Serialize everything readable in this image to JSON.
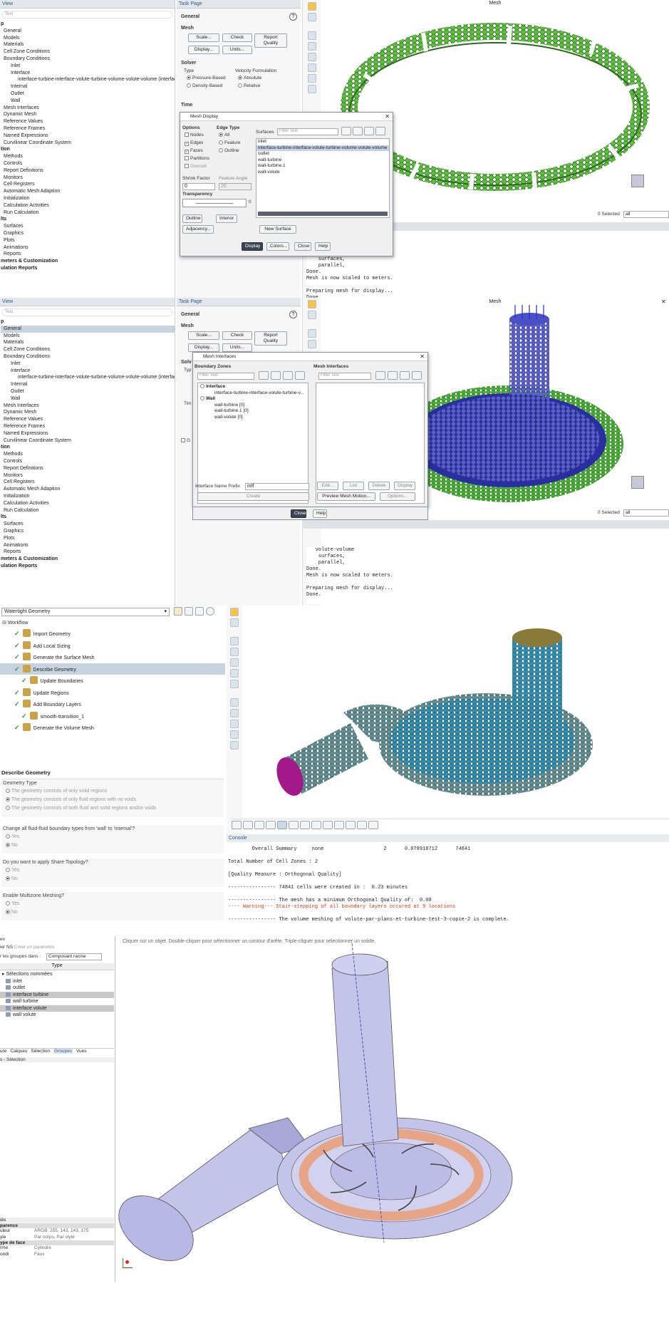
{
  "p1": {
    "tree_header": "View",
    "search_placeholder": "Text",
    "tree": [
      {
        "label": "p",
        "bold": true
      },
      {
        "label": "General",
        "icon": false
      },
      {
        "label": "Models"
      },
      {
        "label": "Materials"
      },
      {
        "label": "Cell Zone Conditions"
      },
      {
        "label": "Boundary Conditions"
      },
      {
        "label": "Inlet",
        "indent": 1
      },
      {
        "label": "Interface",
        "indent": 1
      },
      {
        "label": "interface-turbine-interface-volute-turbine-volume-volute-volume (interfac",
        "indent": 2
      },
      {
        "label": "Internal",
        "indent": 1
      },
      {
        "label": "Outlet",
        "indent": 1
      },
      {
        "label": "Wall",
        "indent": 1
      },
      {
        "label": "Mesh Interfaces"
      },
      {
        "label": "Dynamic Mesh"
      },
      {
        "label": "Reference Values"
      },
      {
        "label": "Reference Frames"
      },
      {
        "label": "Named Expressions"
      },
      {
        "label": "Curvilinear Coordinate System"
      },
      {
        "label": "tion",
        "bold": true
      },
      {
        "label": "Methods"
      },
      {
        "label": "Controls"
      },
      {
        "label": "Report Definitions"
      },
      {
        "label": "Monitors"
      },
      {
        "label": "Cell Registers"
      },
      {
        "label": "Automatic Mesh Adaption"
      },
      {
        "label": "Initialization"
      },
      {
        "label": "Calculation Activities"
      },
      {
        "label": "Run Calculation"
      },
      {
        "label": "lts",
        "bold": true
      },
      {
        "label": "Surfaces"
      },
      {
        "label": "Graphics"
      },
      {
        "label": "Plots"
      },
      {
        "label": "Animations"
      },
      {
        "label": "Reports"
      },
      {
        "label": "meters & Customization",
        "bold": true
      },
      {
        "label": "ulation Reports",
        "bold": true
      }
    ],
    "task_header": "Task Page",
    "general": "General",
    "mesh": "Mesh",
    "scale": "Scale...",
    "check": "Check",
    "report_quality": "Report Quality",
    "display": "Display...",
    "units": "Units...",
    "solver": "Solver",
    "type": "Type",
    "pressure_based": "Pressure-Based",
    "density_based": "Density-Based",
    "velocity_formulation": "Velocity Formulation",
    "absolute": "Absolute",
    "relative": "Relative",
    "time": "Time",
    "viewport_title": "Mesh",
    "selected": "0 Selected",
    "selected_filter": "all",
    "console": "    surfaces,\n    parallel,\nDone.\nMesh is now scaled to meters.\n\nPreparing mesh for display...\nDone.",
    "dialog": {
      "title": "Mesh Display",
      "options": "Options",
      "nodes": "Nodes",
      "edges": "Edges",
      "faces": "Faces",
      "partitions": "Partitions",
      "overset": "Overset",
      "edge_type": "Edge Type",
      "all": "All",
      "feature": "Feature",
      "outline": "Outline",
      "surfaces": "Surfaces",
      "filter": "Filter Text",
      "surface_list": [
        "inlet",
        "interface-turbine-interface-volute-turbine-volume-volute-volume",
        "outlet",
        "wall-turbine",
        "wall-turbine.1",
        "wall-volute"
      ],
      "shrink_factor": "Shrink Factor",
      "shrink_value": "0",
      "feature_angle": "Feature Angle",
      "feature_value": "20",
      "transparency": "Transparency",
      "trans_value": "0",
      "outline_btn": "Outline",
      "interior_btn": "Interior",
      "adjacency_btn": "Adjacency...",
      "new_surface_btn": "New Surface",
      "display_btn": "Display",
      "colors_btn": "Colors...",
      "close_btn": "Close",
      "help_btn": "Help"
    }
  },
  "p2": {
    "tree_header": "View",
    "search_placeholder": "Text",
    "tree": [
      {
        "label": "p",
        "bold": true
      },
      {
        "label": "General",
        "sel": true
      },
      {
        "label": "Models"
      },
      {
        "label": "Materials"
      },
      {
        "label": "Cell Zone Conditions"
      },
      {
        "label": "Boundary Conditions"
      },
      {
        "label": "Inlet",
        "indent": 1
      },
      {
        "label": "Interface",
        "indent": 1
      },
      {
        "label": "interface-turbine-interface-volute-turbine-volume-volute-volume (interfac",
        "indent": 2
      },
      {
        "label": "Internal",
        "indent": 1
      },
      {
        "label": "Outlet",
        "indent": 1
      },
      {
        "label": "Wall",
        "indent": 1
      },
      {
        "label": "Mesh Interfaces"
      },
      {
        "label": "Dynamic Mesh"
      },
      {
        "label": "Reference Values"
      },
      {
        "label": "Reference Frames"
      },
      {
        "label": "Named Expressions"
      },
      {
        "label": "Curvilinear Coordinate System"
      },
      {
        "label": "tion",
        "bold": true
      },
      {
        "label": "Methods"
      },
      {
        "label": "Controls"
      },
      {
        "label": "Report Definitions"
      },
      {
        "label": "Monitors"
      },
      {
        "label": "Cell Registers"
      },
      {
        "label": "Automatic Mesh Adaption"
      },
      {
        "label": "Initialization"
      },
      {
        "label": "Calculation Activities"
      },
      {
        "label": "Run Calculation"
      },
      {
        "label": "lts",
        "bold": true
      },
      {
        "label": "Surfaces"
      },
      {
        "label": "Graphics"
      },
      {
        "label": "Plots"
      },
      {
        "label": "Animations"
      },
      {
        "label": "Reports"
      },
      {
        "label": "meters & Customization",
        "bold": true
      },
      {
        "label": "ulation Reports",
        "bold": true
      }
    ],
    "task_header": "Task Page",
    "general": "General",
    "mesh": "Mesh",
    "scale": "Scale...",
    "check": "Check",
    "report_quality": "Report Quality",
    "display": "Display...",
    "units": "Units...",
    "solver_trunc": "Solv",
    "type_trunc": "Typ",
    "time_trunc": "Tim",
    "grav_trunc": "G",
    "viewport_title": "Mesh",
    "selected": "0 Selected",
    "selected_filter": "all",
    "console": "   volute-volume\n    surfaces,\n    parallel,\nDone.\nMesh is now scaled to meters.\n\nPreparing mesh for display...\nDone.",
    "dialog": {
      "title": "Mesh Interfaces",
      "boundary_zones": "Boundary Zones",
      "mesh_interfaces": "Mesh Interfaces",
      "filter": "Filter Text",
      "interface_group": "Interface",
      "interface_item": "interface-turbine-interface-volute-turbine-v...",
      "wall_group": "Wall",
      "wall_items": [
        "wall-turbine  [0]",
        "wall-turbine.1  [0]",
        "wall-volute  [0]"
      ],
      "edit": "Edit...",
      "list": "List",
      "delete": "Delete",
      "display": "Display",
      "prefix_label": "Interface Name Prefix",
      "prefix_value": "intf",
      "create": "Create",
      "preview": "Preview Mesh Motion...",
      "options": "Options...",
      "close": "Close",
      "help": "Help"
    }
  },
  "p3": {
    "workflow_select": "Watertight Geometry",
    "workflow_root": "Workflow",
    "steps": [
      {
        "label": "Import Geometry",
        "indent": 1
      },
      {
        "label": "Add Local Sizing",
        "indent": 1
      },
      {
        "label": "Generate the Surface Mesh",
        "indent": 1
      },
      {
        "label": "Describe Geometry",
        "indent": 1,
        "sel": true
      },
      {
        "label": "Update Boundaries",
        "indent": 2
      },
      {
        "label": "Update Regions",
        "indent": 1
      },
      {
        "label": "Add Boundary Layers",
        "indent": 1
      },
      {
        "label": "smooth-transition_1",
        "indent": 2
      },
      {
        "label": "Generate the Volume Mesh",
        "indent": 1
      }
    ],
    "describe_title": "Describe Geometry",
    "geometry_type": "Geometry Type",
    "gt_options": [
      "The geometry consists of only solid regions",
      "The geometry consists of only fluid regions with no voids",
      "The geometry consists of both fluid and solid regions and/or voids"
    ],
    "q1": "Change all fluid-fluid boundary types from 'wall' to 'internal'?",
    "q2": "Do you want to apply Share Topology?",
    "q3": "Enable Multizone Meshing?",
    "yes": "Yes",
    "no": "No",
    "console_header": "Console",
    "console": "        Overall Summary     none                    2      0.078918712      74841\n\nTotal Number of Cell Zones : 2\n\n[Quality Measure : Orthogonal Quality]\n\n---------------- 74841 cells were created in :  0.23 minutes\n\n---------------- The mesh has a minimum Orthogonal Quality of:  0.08",
    "console_warning": "---- Warning--- Stair-stepping of all boundary layers occured at 9 locations",
    "console_end": "---------------- The volume meshing of volute-par-plans-et-turbine-test-3-copie-2 is complete.",
    "colors": {
      "teal": "#2e8fb0",
      "olive": "#8a7a3a",
      "magenta": "#a3198a",
      "grey": "#5f8f93"
    }
  },
  "p4": {
    "header_trunc": "es",
    "create_param_prefix": "ier NS",
    "create_param": "Créer un paramètre",
    "group_by": "r les groupes dans :",
    "group_value": "Composant racine",
    "col_type": "Type",
    "named_selections": "Sélections nommées",
    "items": [
      "inlet",
      "outlet",
      "interface turbine",
      "wall turbine",
      "interface volute",
      "wall volute"
    ],
    "highlight": [
      2,
      4
    ],
    "tabs": [
      "ure",
      "Calques",
      "Sélection",
      "Groupes",
      "Vues"
    ],
    "active_tab": "Groupes",
    "selection_label": "s - Sélection",
    "props_header": "iés",
    "prop_group1": "parence",
    "props": [
      {
        "k": "uleur",
        "v": "ARGB: 255, 143, 143, 175"
      },
      {
        "k": "yle",
        "v": "Par corps, Par style"
      }
    ],
    "prop_group2": "ype de face",
    "props2": [
      {
        "k": "rme",
        "v": "Cylindre"
      },
      {
        "k": "ondi",
        "v": "Faux"
      }
    ],
    "hint": "Cliquer sur un objet. Double-cliquer pour sélectionner un contour d'arête. Triple-cliquer pour sélectionner un solide.",
    "colors": {
      "body": "#c4c4ea",
      "interface": "#e8a07a"
    }
  }
}
